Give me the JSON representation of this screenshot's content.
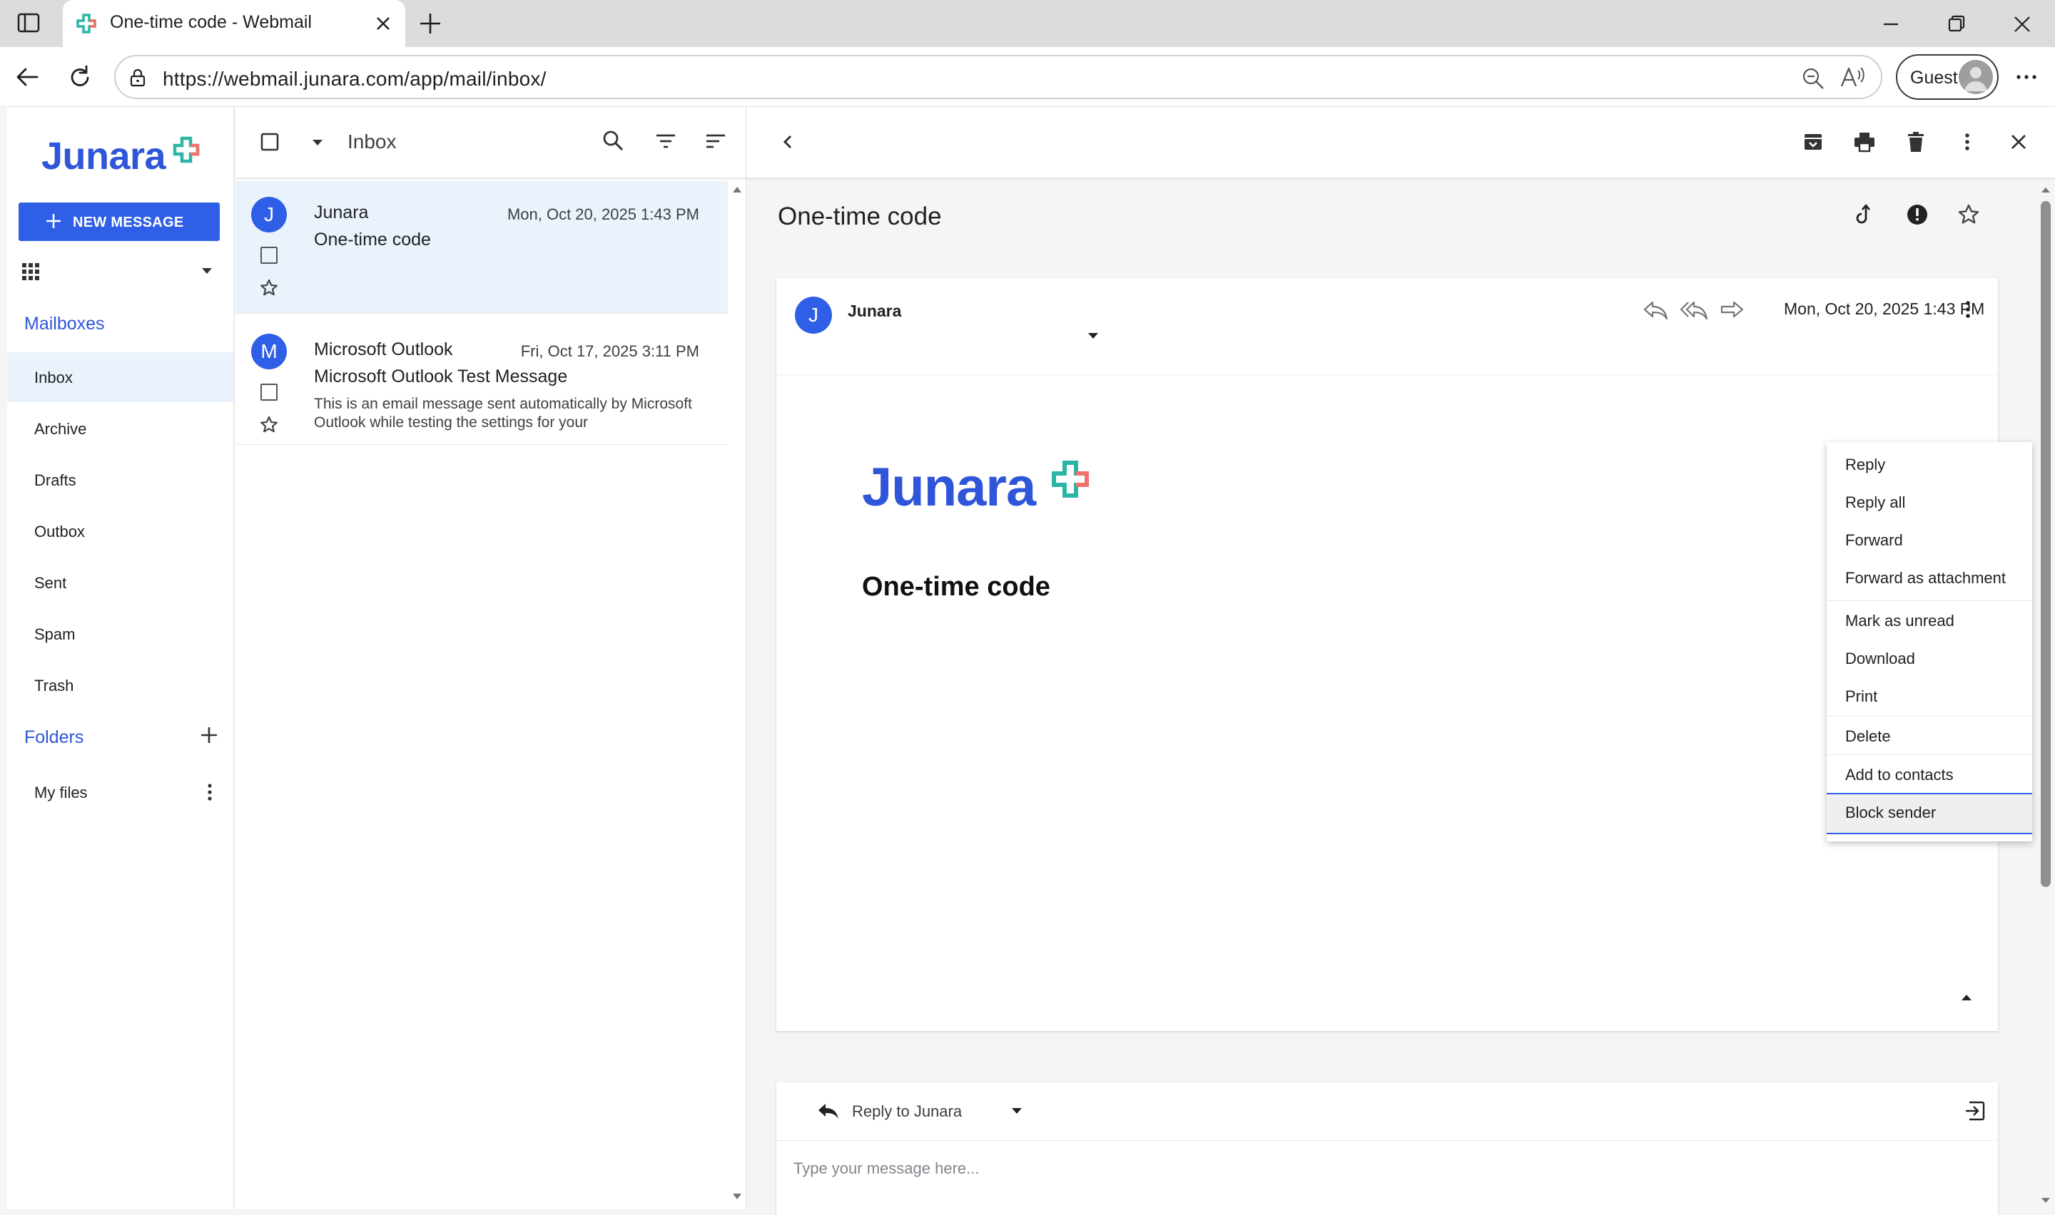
{
  "browser": {
    "tab_title": "One-time code - Webmail",
    "url": "https://webmail.junara.com/app/mail/inbox/",
    "guest_label": "Guest"
  },
  "sidebar": {
    "logo": "Junara",
    "new_message_label": "NEW MESSAGE",
    "mailboxes_label": "Mailboxes",
    "mailboxes": [
      {
        "label": "Inbox",
        "active": true
      },
      {
        "label": "Archive"
      },
      {
        "label": "Drafts"
      },
      {
        "label": "Outbox"
      },
      {
        "label": "Sent"
      },
      {
        "label": "Spam"
      },
      {
        "label": "Trash"
      }
    ],
    "folders_label": "Folders",
    "folders": [
      {
        "label": "My files"
      }
    ]
  },
  "list": {
    "title": "Inbox",
    "messages": [
      {
        "avatar": "J",
        "sender": "Junara",
        "date": "Mon, Oct 20, 2025 1:43 PM",
        "subject": "One-time code",
        "preview": ""
      },
      {
        "avatar": "M",
        "sender": "Microsoft Outlook",
        "date": "Fri, Oct 17, 2025 3:11 PM",
        "subject": "Microsoft Outlook Test Message",
        "preview": "This is an email message sent automatically by Microsoft Outlook while testing the settings for your"
      }
    ]
  },
  "reader": {
    "subject": "One-time code",
    "sender_avatar": "J",
    "sender": "Junara",
    "date": "Mon, Oct 20, 2025 1:43 PM",
    "body_logo": "Junara",
    "body_heading": "One-time code",
    "reply_label": "Reply to Junara",
    "reply_placeholder": "Type your message here..."
  },
  "menu": {
    "items": [
      {
        "label": "Reply"
      },
      {
        "label": "Reply all"
      },
      {
        "label": "Forward"
      },
      {
        "label": "Forward as attachment"
      },
      {
        "label": "Mark as unread"
      },
      {
        "label": "Download"
      },
      {
        "label": "Print"
      },
      {
        "label": "Delete"
      },
      {
        "label": "Add to contacts"
      },
      {
        "label": "Block sender"
      }
    ]
  },
  "colors": {
    "brand": "#2f56d8",
    "accent": "#2f5fe6",
    "selected_row": "#eaf3fb",
    "logo_mark_teal": "#2bb5a6",
    "logo_mark_coral": "#f0706a"
  },
  "icons": {
    "logo_mark": "medical-cross-icon",
    "toolbar": [
      "select-all-checkbox",
      "caret-down-icon",
      "search-icon",
      "filter-icon",
      "sort-icon",
      "chevron-left-icon"
    ],
    "reader_toolbar": [
      "archive-icon",
      "print-icon",
      "delete-icon",
      "more-vertical-icon",
      "close-icon"
    ],
    "subject_actions": [
      "flag-icon",
      "priority-icon",
      "star-icon"
    ],
    "card_actions": [
      "reply-icon",
      "reply-all-icon",
      "forward-icon",
      "more-vertical-icon"
    ]
  }
}
